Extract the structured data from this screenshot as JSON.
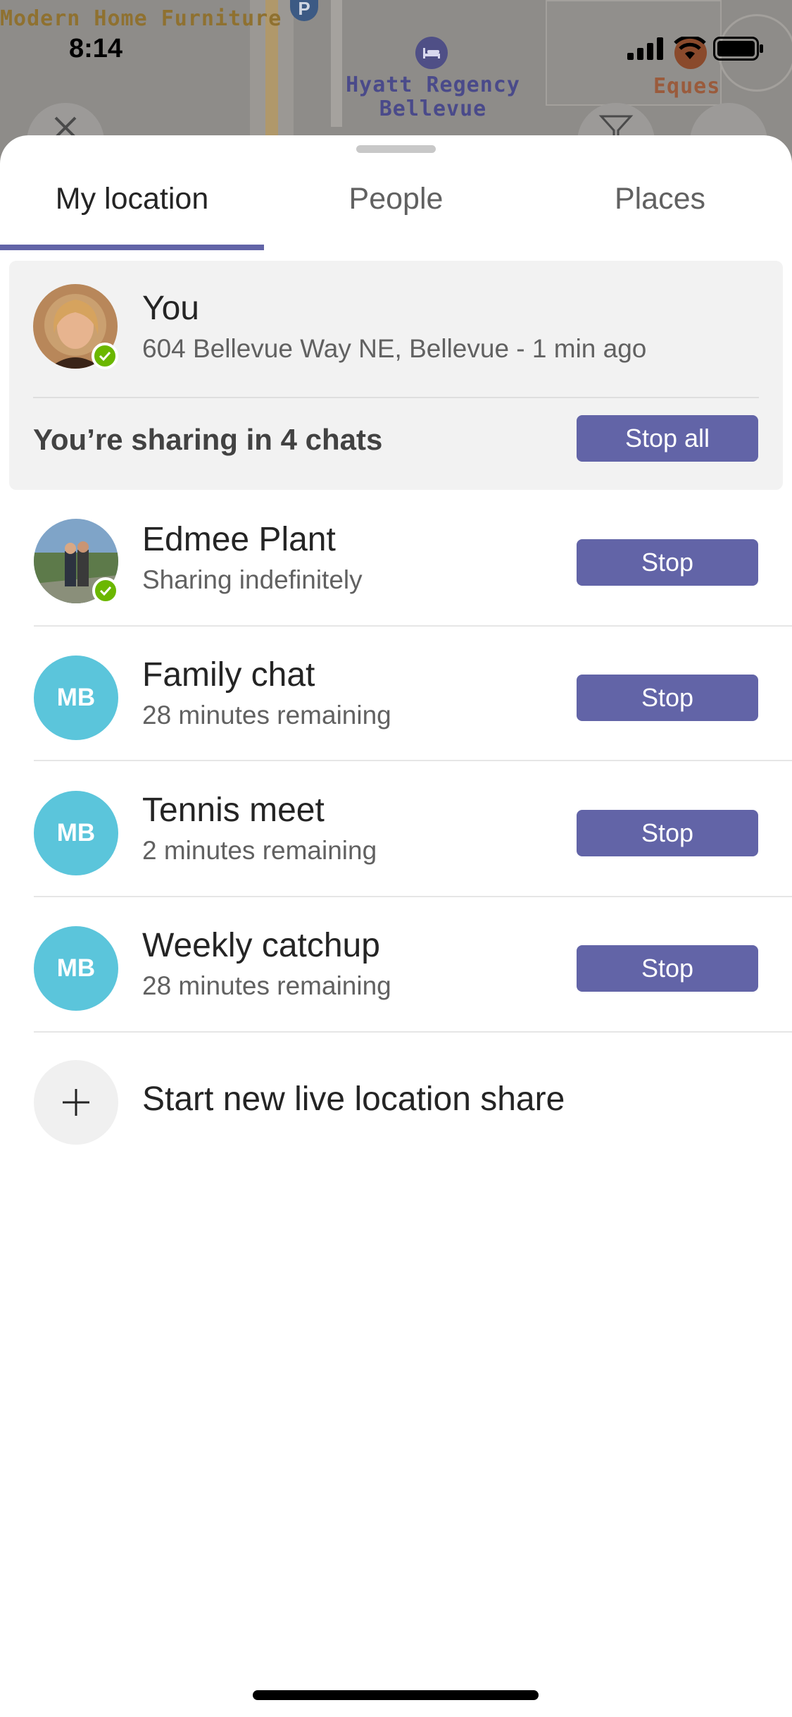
{
  "status_bar": {
    "time": "8:14"
  },
  "map": {
    "labels": {
      "furniture": "Modern Home Furniture",
      "hotel_line1": "Hyatt Regency",
      "hotel_line2": "Bellevue",
      "eques": "Eques"
    },
    "parking_symbol": "P",
    "icons": [
      "close-icon",
      "filter-icon",
      "hotel-icon",
      "parking-icon"
    ]
  },
  "tabs": [
    {
      "label": "My location",
      "active": true
    },
    {
      "label": "People",
      "active": false
    },
    {
      "label": "Places",
      "active": false
    }
  ],
  "you": {
    "name": "You",
    "address": "604 Bellevue Way NE, Bellevue - 1 min ago",
    "sharing_text": "You’re sharing in 4 chats",
    "stop_all_label": "Stop all",
    "presence": "available"
  },
  "shares": [
    {
      "title": "Edmee Plant",
      "subtitle": "Sharing indefinitely",
      "avatar": "photo",
      "button": "Stop"
    },
    {
      "title": "Family chat",
      "subtitle": "28 minutes remaining",
      "avatar": "MB",
      "button": "Stop"
    },
    {
      "title": "Tennis meet",
      "subtitle": "2 minutes remaining",
      "avatar": "MB",
      "button": "Stop"
    },
    {
      "title": "Weekly catchup",
      "subtitle": "28 minutes remaining",
      "avatar": "MB",
      "button": "Stop"
    }
  ],
  "new_share": {
    "label": "Start new live location share",
    "icon": "plus-icon"
  },
  "colors": {
    "accent": "#6264a7",
    "presence_green": "#6bb700",
    "initials_bg": "#5bc5db",
    "card_bg": "#f2f2f2"
  }
}
